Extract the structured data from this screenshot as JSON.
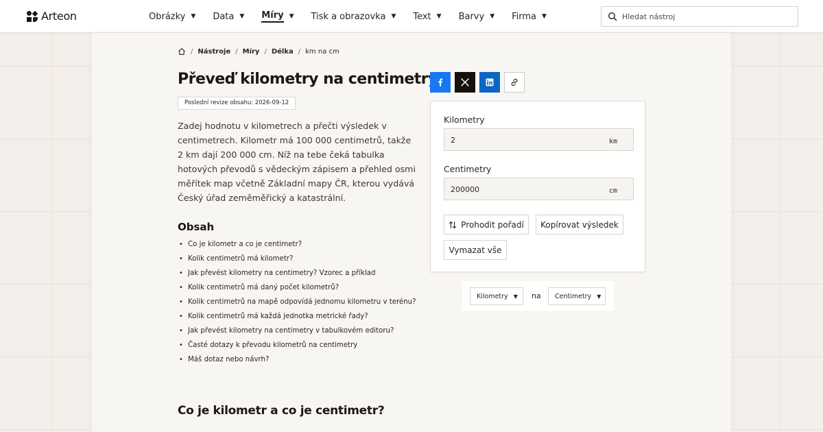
{
  "header": {
    "logo_text": "Arteon",
    "nav": [
      {
        "label": "Obrázky",
        "active": false
      },
      {
        "label": "Data",
        "active": false
      },
      {
        "label": "Míry",
        "active": true
      },
      {
        "label": "Tisk a obrazovka",
        "active": false
      },
      {
        "label": "Text",
        "active": false
      },
      {
        "label": "Barvy",
        "active": false
      },
      {
        "label": "Firma",
        "active": false
      }
    ],
    "search_placeholder": "Hledat nástroj",
    "caret": "▼"
  },
  "breadcrumb": {
    "items": [
      "Nástroje",
      "Míry",
      "Délka",
      "km na cm"
    ],
    "separator": "/"
  },
  "page": {
    "title": "Převeď kilometry na centimetry",
    "revision": "Poslední revize obsahu: 2026-09-12",
    "intro": "Zadej hodnotu v kilometrech a přečti výsledek v centimetrech. Kilometr má 100 000 centimetrů, takže 2 km dají 200 000 cm. Níž na tebe čeká tabulka hotových převodů s vědeckým zápisem a přehled osmi měřítek map včetně Základní mapy ČR, kterou vydává Český úřad zeměměřický a katastrální."
  },
  "toc": {
    "title": "Obsah",
    "items": [
      "Co je kilometr a co je centimetr?",
      "Kolik centimetrů má kilometr?",
      "Jak převést kilometry na centimetry? Vzorec a příklad",
      "Kolik centimetrů má daný počet kilometrů?",
      "Kolik centimetrů na mapě odpovídá jednomu kilometru v terénu?",
      "Kolik centimetrů má každá jednotka metrické řady?",
      "Jak převést kilometry na centimetry v tabulkovém editoru?",
      "Časté dotazy k převodu kilometrů na centimetry",
      "Máš dotaz nebo návrh?"
    ]
  },
  "section_heading": "Co je kilometr a co je centimetr?",
  "share": {
    "icons": [
      "facebook-icon",
      "x-icon",
      "linkedin-icon",
      "link-icon"
    ]
  },
  "converter": {
    "from_label": "Kilometry",
    "from_value": "2",
    "from_unit": "km",
    "to_label": "Centimetry",
    "to_value": "200000",
    "to_unit": "cm",
    "swap_label": "Prohodit pořadí",
    "copy_label": "Kopírovat výsledek",
    "clear_label": "Vymazat vše"
  },
  "unit_selector": {
    "from": "Kilometry",
    "connector": "na",
    "to": "Centimetry"
  },
  "colors": {
    "facebook": "#1877f2",
    "x": "#15110d",
    "linkedin": "#0a66c2",
    "text": "#2b2521"
  }
}
